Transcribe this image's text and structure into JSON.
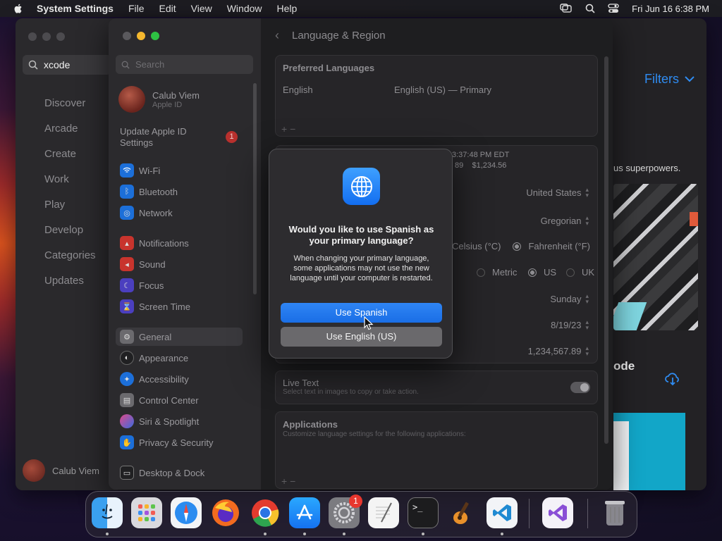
{
  "menubar": {
    "app_name": "System Settings",
    "menus": [
      "File",
      "Edit",
      "View",
      "Window",
      "Help"
    ],
    "datetime": "Fri Jun 16  6:38 PM"
  },
  "app_store": {
    "search_value": "xcode",
    "nav_items": [
      "Discover",
      "Arcade",
      "Create",
      "Work",
      "Play",
      "Develop",
      "Categories",
      "Updates"
    ],
    "user_name": "Calub Viem",
    "filters_label": "Filters",
    "tagline": "us superpowers.",
    "app_title": "ode"
  },
  "settings": {
    "search_placeholder": "Search",
    "account": {
      "name": "Calub Viem",
      "subtitle": "Apple ID"
    },
    "update_label": "Update Apple ID Settings",
    "update_badge": "1",
    "sidebar_items": [
      {
        "label": "Wi-Fi",
        "icon": "wifi-icon",
        "color": "#1c6fd9"
      },
      {
        "label": "Bluetooth",
        "icon": "bluetooth-icon",
        "color": "#1c6fd9"
      },
      {
        "label": "Network",
        "icon": "globe-icon",
        "color": "#1c6fd9"
      },
      {
        "label": "Notifications",
        "icon": "bell-icon",
        "color": "#c8342d"
      },
      {
        "label": "Sound",
        "icon": "speaker-icon",
        "color": "#c8342d"
      },
      {
        "label": "Focus",
        "icon": "moon-icon",
        "color": "#4b3fbf"
      },
      {
        "label": "Screen Time",
        "icon": "hourglass-icon",
        "color": "#4b3fbf"
      },
      {
        "label": "General",
        "icon": "gear-icon",
        "color": "#6b6a6e"
      },
      {
        "label": "Appearance",
        "icon": "appearance-icon",
        "color": "#202022"
      },
      {
        "label": "Accessibility",
        "icon": "accessibility-icon",
        "color": "#1c6fd9"
      },
      {
        "label": "Control Center",
        "icon": "control-center-icon",
        "color": "#6b6a6e"
      },
      {
        "label": "Siri & Spotlight",
        "icon": "siri-icon",
        "color": "#8a3fbf"
      },
      {
        "label": "Privacy & Security",
        "icon": "hand-icon",
        "color": "#1c6fd9"
      },
      {
        "label": "Desktop & Dock",
        "icon": "dock-icon",
        "color": "#202022"
      }
    ],
    "header_title": "Language & Region",
    "preferred_languages_title": "Preferred Languages",
    "language_name": "English",
    "language_detail": "English (US) — Primary",
    "format_preview_time": "3:37:48 PM EDT",
    "format_preview_num": "89    $1,234.56",
    "region_value": "United States",
    "calendar_value": "Gregorian",
    "temp_celsius": "Celsius (°C)",
    "temp_fahrenheit": "Fahrenheit (°F)",
    "measure_metric": "Metric",
    "measure_us": "US",
    "measure_uk": "UK",
    "first_day_value": "Sunday",
    "date_format_value": "8/19/23",
    "number_format_value": "1,234,567.89",
    "live_text_title": "Live Text",
    "live_text_desc": "Select text in images to copy or take action.",
    "applications_title": "Applications",
    "applications_desc": "Customize language settings for the following applications:",
    "plus_minus": "+  −"
  },
  "dialog": {
    "title": "Would you like to use Spanish as your primary language?",
    "message": "When changing your primary language, some applications may not use the new language until your computer is restarted.",
    "primary_button": "Use Spanish",
    "secondary_button": "Use English (US)"
  },
  "dock": {
    "badge_count": "1",
    "apps": [
      "finder-icon",
      "launchpad-icon",
      "safari-icon",
      "firefox-icon",
      "chrome-icon",
      "app-store-icon",
      "system-settings-icon",
      "textedit-icon",
      "terminal-icon",
      "garageband-icon",
      "vscode-icon",
      "visual-studio-icon",
      "trash-icon"
    ]
  },
  "colors": {
    "accent": "#1a6ee6",
    "link": "#2f8cf2",
    "badge": "#e8362e"
  }
}
